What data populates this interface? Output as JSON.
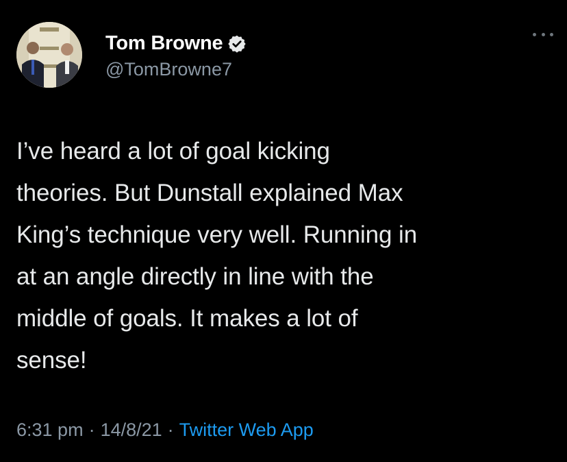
{
  "author": {
    "display_name": "Tom Browne",
    "handle": "@TomBrowne7",
    "verified": true
  },
  "tweet": {
    "text": "I’ve heard a lot of goal kicking\ntheories. But Dunstall explained Max\nKing’s technique very well. Running in\nat an angle directly in line with the\nmiddle of goals. It makes a lot of\nsense!",
    "time": "6:31 pm",
    "date": "14/8/21",
    "separator": "·",
    "source": "Twitter Web App"
  },
  "icons": {
    "verified": "verified-badge-icon",
    "more": "more-options-icon"
  },
  "colors": {
    "background": "#000000",
    "text": "#e7e9ea",
    "secondary": "#8b98a5",
    "accent": "#1d9bf0"
  }
}
